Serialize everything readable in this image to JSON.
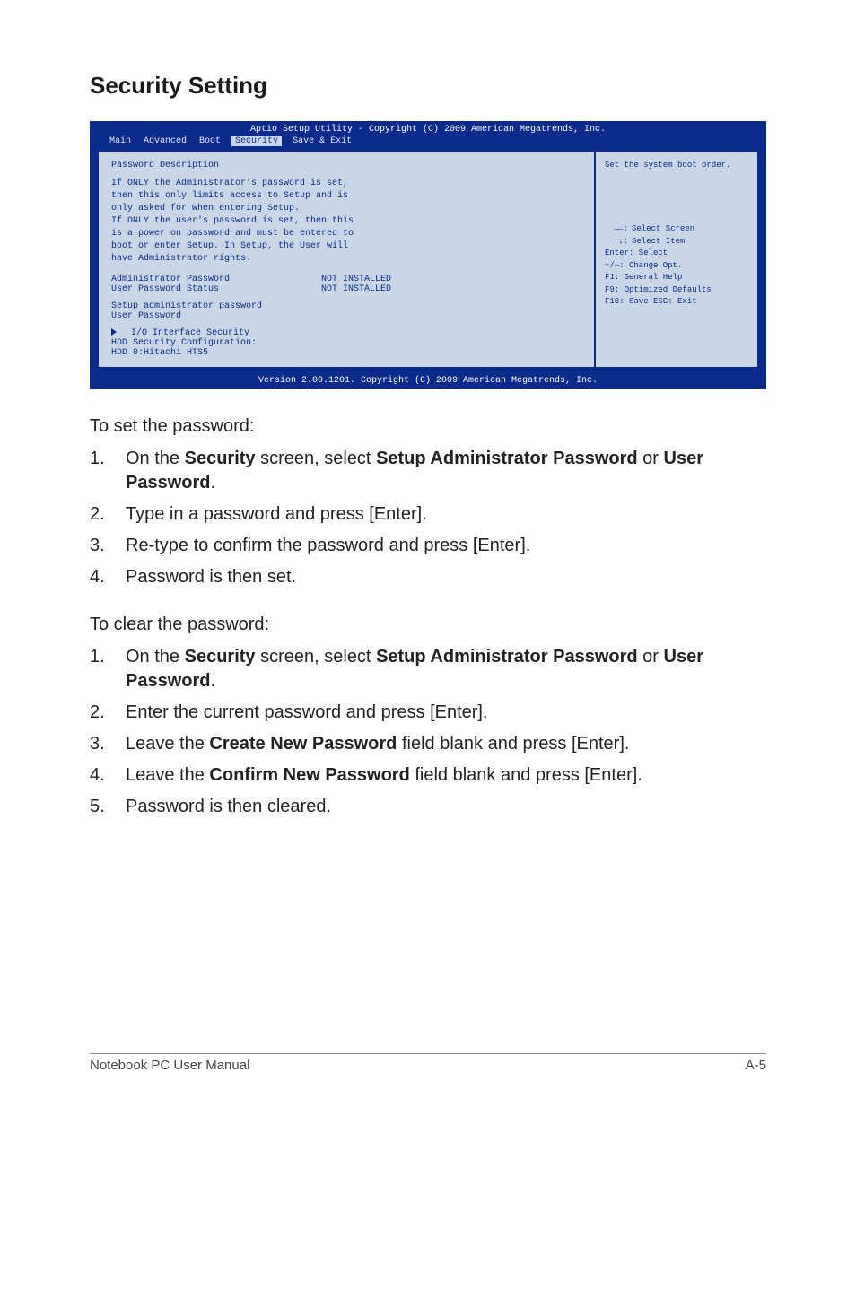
{
  "heading": "Security Setting",
  "bios": {
    "title": "Aptio Setup Utility - Copyright (C) 2009 American Megatrends, Inc.",
    "tabs": {
      "main": "Main",
      "advanced": "Advanced",
      "boot": "Boot",
      "security": "Security",
      "save_exit": "Save & Exit"
    },
    "left": {
      "pwdesc_title": "Password Description",
      "pwdesc_text": "If ONLY the Administrator's password is set,\nthen this only limits access to Setup and is\nonly asked for when entering Setup.\nIf ONLY the user's password is set, then this\nis a power on password and must be entered to\nboot or enter Setup. In Setup, the User will\nhave Administrator rights.",
      "admin_pw_label": "Administrator Password",
      "admin_pw_val": "NOT INSTALLED",
      "user_pw_status_label": "User Password Status",
      "user_pw_status_val": "NOT INSTALLED",
      "setup_admin_pw": "Setup administrator password",
      "user_password": "User Password",
      "io_interface_security": "I/O Interface Security",
      "hdd_sec_conf": "HDD Security Configuration:",
      "hdd_item": "HDD 0:Hitachi HTS5"
    },
    "right": {
      "hint": "Set the system boot order.",
      "legend": {
        "sel_screen": "Select Screen",
        "sel_item": "Select Item",
        "enter_select": "Enter: Select",
        "change_opt": "+/—:  Change Opt.",
        "f1": "F1:    General Help",
        "f9": "F9:    Optimized Defaults",
        "f10": "F10:  Save    ESC:  Exit"
      }
    },
    "footer": "Version 2.00.1201. Copyright (C) 2009 American Megatrends, Inc."
  },
  "set_pw_intro": "To set the password:",
  "set_steps": {
    "s1_pre": "On the ",
    "s1_b1": "Security",
    "s1_mid": " screen, select ",
    "s1_b2": "Setup Administrator Password",
    "s1_or": " or ",
    "s1_b3": "User Password",
    "s1_end": ".",
    "s2": "Type in a password and press [Enter].",
    "s3": "Re-type to confirm the password and press [Enter].",
    "s4": "Password is then set."
  },
  "clear_pw_intro": "To clear the password:",
  "clear_steps": {
    "c1_pre": "On the ",
    "c1_b1": "Security",
    "c1_mid": " screen, select ",
    "c1_b2": "Setup Administrator Password",
    "c1_or": " or ",
    "c1_b3": "User Password",
    "c1_end": ".",
    "c2": "Enter the current password and press [Enter].",
    "c3_pre": "Leave the ",
    "c3_b": "Create New Password",
    "c3_post": " field blank and press [Enter].",
    "c4_pre": "Leave the ",
    "c4_b": "Confirm New Password",
    "c4_post": " field blank and press [Enter].",
    "c5": "Password is then cleared."
  },
  "footer_left": "Notebook PC User Manual",
  "footer_right": "A-5",
  "nums": {
    "n1": "1.",
    "n2": "2.",
    "n3": "3.",
    "n4": "4.",
    "n5": "5."
  }
}
